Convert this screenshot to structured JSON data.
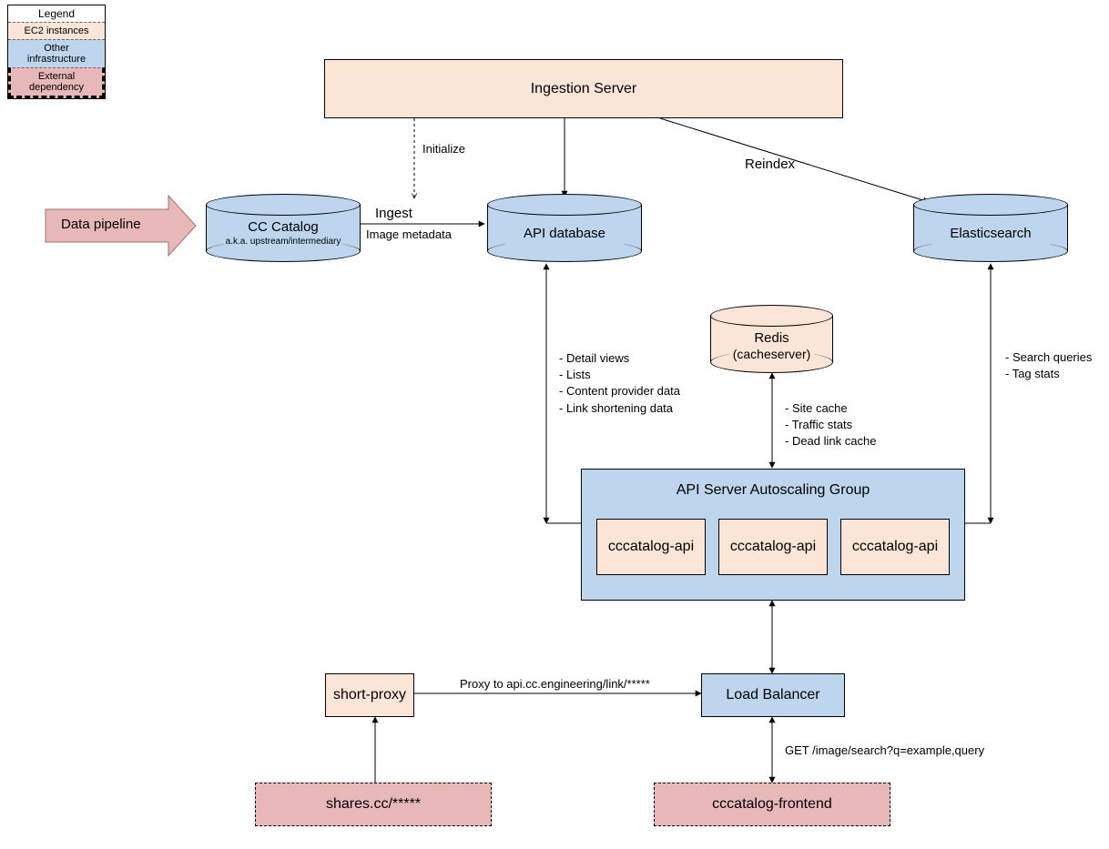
{
  "legend": {
    "title": "Legend",
    "items": [
      {
        "label": "EC2 instances",
        "class": "ec2"
      },
      {
        "label": "Other infrastructure",
        "class": "infra"
      },
      {
        "label": "External dependency",
        "class": "ext"
      }
    ]
  },
  "nodes": {
    "data_pipeline": {
      "label": "Data pipeline"
    },
    "cc_catalog": {
      "label": "CC Catalog",
      "sub": "a.k.a. upstream/intermediary"
    },
    "ingestion_server": {
      "label": "Ingestion Server"
    },
    "api_database": {
      "label": "API database"
    },
    "elasticsearch": {
      "label": "Elasticsearch"
    },
    "redis": {
      "label": "Redis",
      "sub": "(cacheserver)"
    },
    "api_autoscale": {
      "label": "API Server Autoscaling Group"
    },
    "api_instance": {
      "label": "cccatalog-api"
    },
    "short_proxy": {
      "label": "short-proxy"
    },
    "load_balancer": {
      "label": "Load Balancer"
    },
    "shares_cc": {
      "label": "shares.cc/*****"
    },
    "frontend": {
      "label": "cccatalog-frontend"
    }
  },
  "edges": {
    "ingest": {
      "label": "Ingest",
      "sub": "Image metadata"
    },
    "initialize": {
      "label": "Initialize"
    },
    "reindex": {
      "label": "Reindex"
    },
    "api_db_notes": {
      "lines": [
        "- Detail views",
        "- Lists",
        "- Content provider data",
        "- Link shortening data"
      ]
    },
    "redis_notes": {
      "lines": [
        "- Site cache",
        "- Traffic stats",
        "- Dead link cache"
      ]
    },
    "es_notes": {
      "lines": [
        "- Search queries",
        "- Tag stats"
      ]
    },
    "proxy": {
      "label": "Proxy to api.cc.engineering/link/*****"
    },
    "get_search": {
      "label": "GET /image/search?q=example,query"
    }
  }
}
